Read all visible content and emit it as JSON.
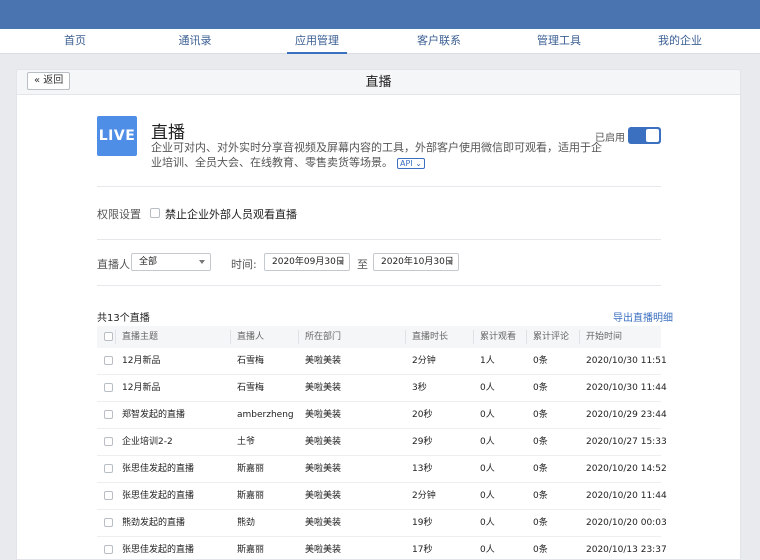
{
  "nav": {
    "items": [
      {
        "label": "首页"
      },
      {
        "label": "通讯录"
      },
      {
        "label": "应用管理",
        "active": true
      },
      {
        "label": "客户联系"
      },
      {
        "label": "管理工具"
      },
      {
        "label": "我的企业"
      }
    ]
  },
  "header": {
    "back_label": "« 返回",
    "title": "直播"
  },
  "app": {
    "logo_text": "LIVE",
    "name": "直播",
    "description": "企业可对内、对外实时分享音视频及屏幕内容的工具，外部客户使用微信即可观看，适用于企业培训、全员大会、在线教育、零售卖货等场景。",
    "api_label": "API ⌄",
    "status_label": "已启用",
    "enabled": true
  },
  "permissions": {
    "label": "权限设置",
    "checkbox_label": "禁止企业外部人员观看直播",
    "checked": false
  },
  "filters": {
    "host_label": "直播人:",
    "host_value": "全部",
    "time_label": "时间:",
    "start_date": "2020年09月30日",
    "to_label": "至",
    "end_date": "2020年10月30日"
  },
  "summary": {
    "count_text": "共13个直播",
    "export_label": "导出直播明细"
  },
  "table": {
    "columns": [
      "直播主题",
      "直播人",
      "所在部门",
      "直播时长",
      "累计观看",
      "累计评论",
      "开始时间"
    ],
    "rows": [
      [
        "12月新品",
        "石雪梅",
        "美啦美装",
        "2分钟",
        "1人",
        "0条",
        "2020/10/30 11:51"
      ],
      [
        "12月新品",
        "石雪梅",
        "美啦美装",
        "3秒",
        "0人",
        "0条",
        "2020/10/30 11:44"
      ],
      [
        "郑智发起的直播",
        "amberzheng",
        "美啦美装",
        "20秒",
        "0人",
        "0条",
        "2020/10/29 23:44"
      ],
      [
        "企业培训2-2",
        "土爷",
        "美啦美装",
        "29秒",
        "0人",
        "0条",
        "2020/10/27 15:33"
      ],
      [
        "张思佳发起的直播",
        "斯嘉丽",
        "美啦美装",
        "13秒",
        "0人",
        "0条",
        "2020/10/20 14:52"
      ],
      [
        "张思佳发起的直播",
        "斯嘉丽",
        "美啦美装",
        "2分钟",
        "0人",
        "0条",
        "2020/10/20 11:44"
      ],
      [
        "熊劲发起的直播",
        "熊劲",
        "美啦美装",
        "19秒",
        "0人",
        "0条",
        "2020/10/20 00:03"
      ],
      [
        "张思佳发起的直播",
        "斯嘉丽",
        "美啦美装",
        "17秒",
        "0人",
        "0条",
        "2020/10/13 23:37"
      ]
    ]
  },
  "colors": {
    "topbar": "#4a74b0",
    "accent": "#3b6fc0",
    "logo": "#4f8ee6"
  }
}
